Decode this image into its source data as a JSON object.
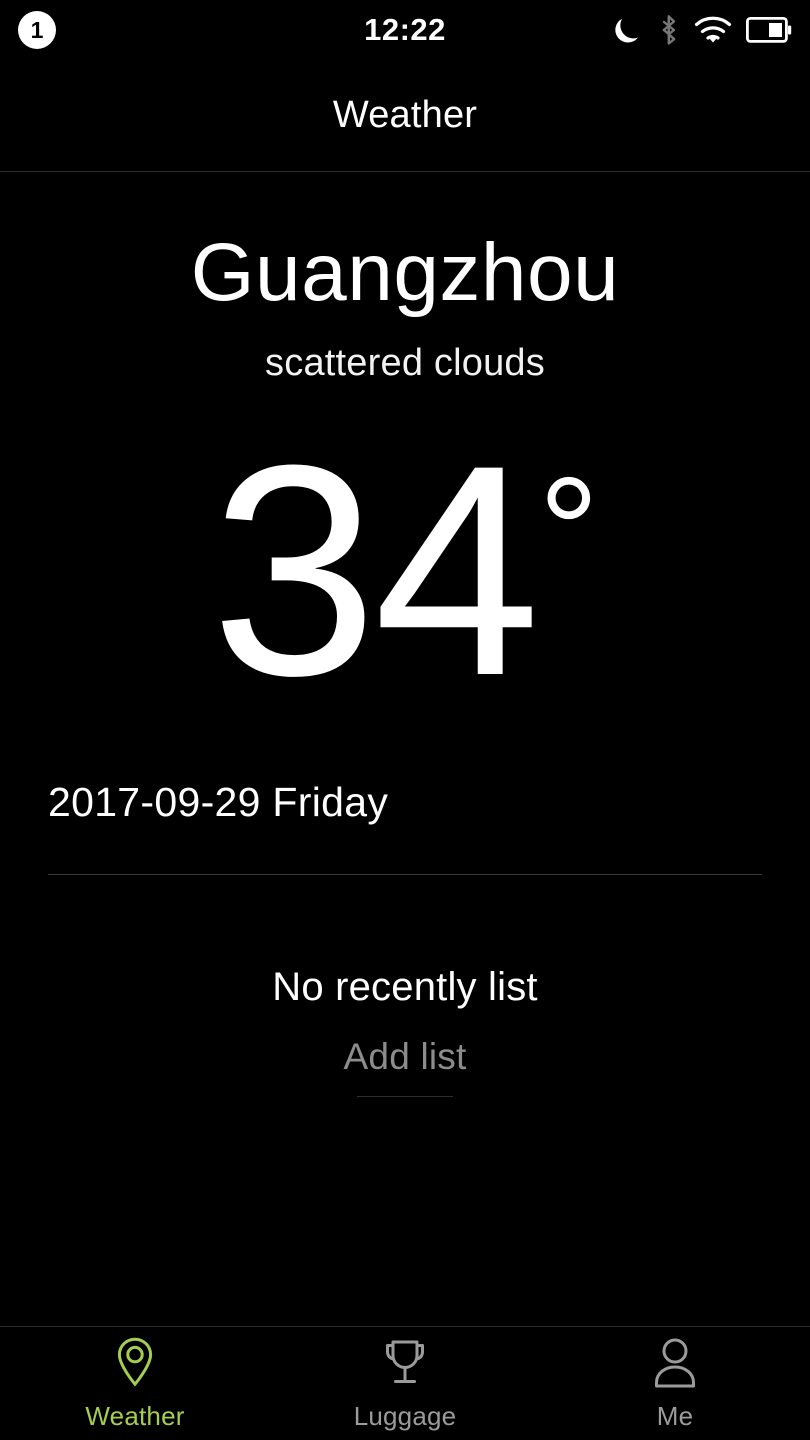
{
  "status_bar": {
    "sim_badge": "1",
    "time": "12:22",
    "icons": [
      {
        "name": "do-not-disturb-moon-icon",
        "state": "on",
        "color": "#ffffff"
      },
      {
        "name": "bluetooth-icon",
        "state": "off",
        "color": "#777777"
      },
      {
        "name": "wifi-icon",
        "state": "on",
        "color": "#ffffff"
      },
      {
        "name": "battery-icon",
        "state": "partial",
        "color": "#ffffff"
      }
    ]
  },
  "header": {
    "title": "Weather"
  },
  "weather": {
    "city": "Guangzhou",
    "description": "scattered clouds",
    "temperature": "34",
    "degree_symbol": "°",
    "date": "2017-09-29 Friday"
  },
  "recent": {
    "empty_text": "No recently list",
    "add_label": "Add list"
  },
  "tabbar": {
    "items": [
      {
        "label": "Weather",
        "icon": "map-pin-icon",
        "active": true
      },
      {
        "label": "Luggage",
        "icon": "trophy-icon",
        "active": false
      },
      {
        "label": "Me",
        "icon": "person-icon",
        "active": false
      }
    ]
  },
  "colors": {
    "background": "#000000",
    "accent_green": "#a5ce4e",
    "inactive_gray": "#9b9b9b",
    "muted_text": "#8c8c8c",
    "divider": "#2c2c2c"
  }
}
